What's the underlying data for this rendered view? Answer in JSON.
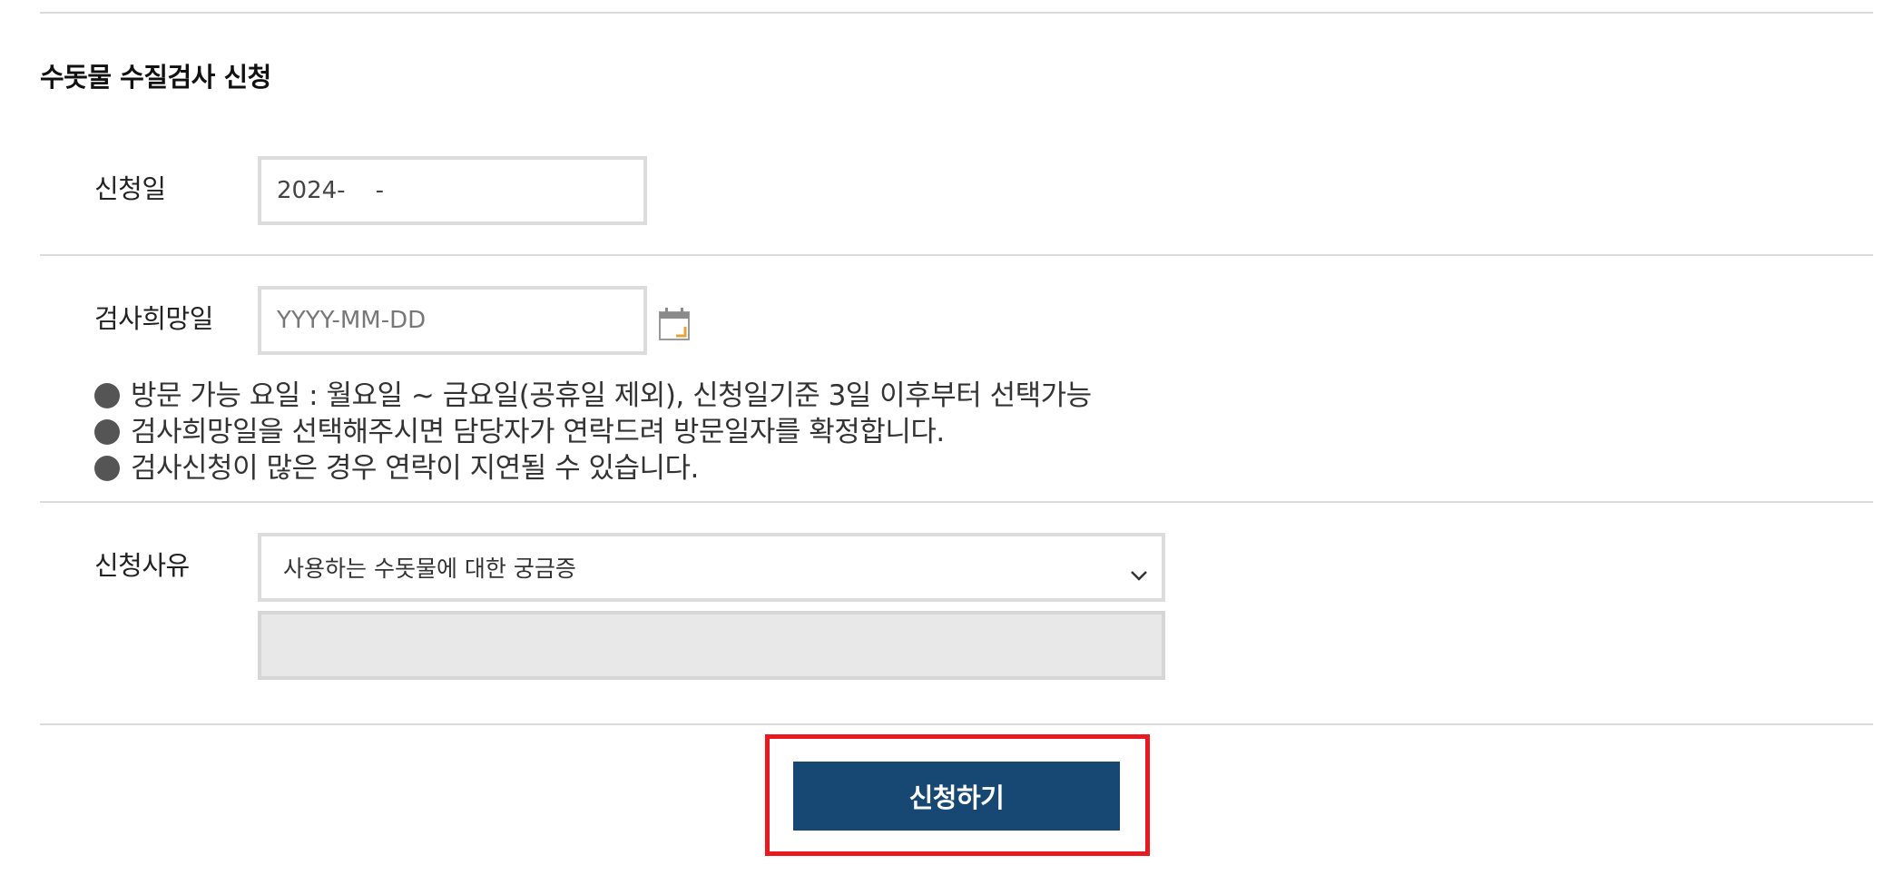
{
  "form": {
    "title": "수돗물 수질검사 신청",
    "apply_date": {
      "label": "신청일",
      "value": "2024-    -"
    },
    "desired_date": {
      "label": "검사희망일",
      "placeholder": "YYYY-MM-DD",
      "icon": "calendar-icon"
    },
    "notes": [
      "방문 가능 요일 : 월요일 ~ 금요일(공휴일 제외), 신청일기준 3일 이후부터 선택가능",
      "검사희망일을 선택해주시면 담당자가 연락드려 방문일자를 확정합니다.",
      "검사신청이 많은 경우 연락이 지연될 수 있습니다."
    ],
    "reason": {
      "label": "신청사유",
      "selected": "사용하는 수돗물에 대한 궁금증",
      "icon": "chevron-down-icon"
    },
    "submit_label": "신청하기"
  },
  "colors": {
    "submit_bg": "#174773",
    "highlight_border": "#e8191f",
    "calendar_accent": "#e8a23a"
  }
}
